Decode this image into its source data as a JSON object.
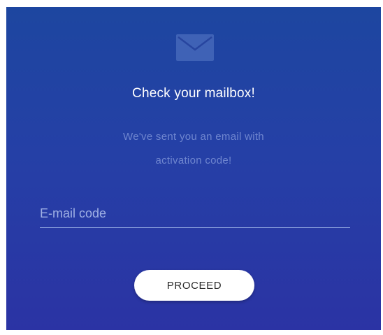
{
  "icon": {
    "name": "envelope-icon"
  },
  "header": {
    "title": "Check your mailbox!",
    "subtitle_line1": "We've sent you an email with",
    "subtitle_line2": "activation code!"
  },
  "form": {
    "code_placeholder": "E-mail code",
    "code_value": "",
    "proceed_label": "PROCEED"
  },
  "colors": {
    "background_top": "#1d46a0",
    "background_bottom": "#2b33a4",
    "subtitle_text": "#6f86cf",
    "button_bg": "#ffffff"
  }
}
